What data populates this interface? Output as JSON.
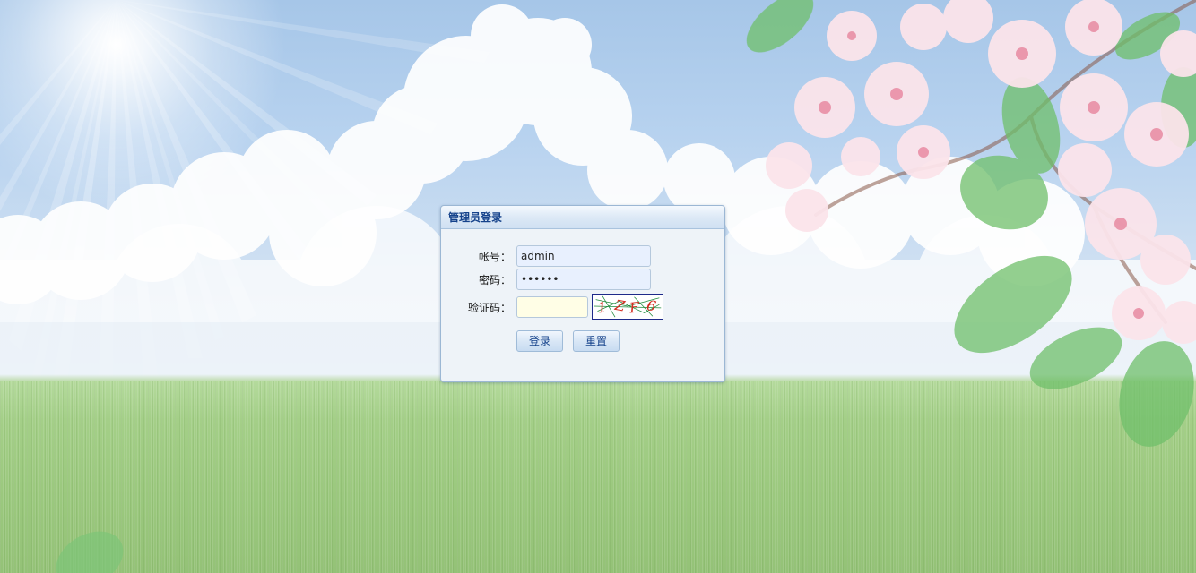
{
  "login": {
    "title": "管理员登录",
    "account_label": "帐号：",
    "account_value": "admin",
    "password_label": "密码：",
    "password_value": "123456",
    "captcha_label": "验证码：",
    "captcha_value": "",
    "captcha_text": "1ZF6",
    "login_button": "登录",
    "reset_button": "重置"
  },
  "colors": {
    "title_text": "#15428b",
    "panel_bg": "#eef3f8",
    "panel_border": "#9bb7d4",
    "captcha_glyphs": "#d42a1e",
    "captcha_lines": "#1e8a3a"
  }
}
